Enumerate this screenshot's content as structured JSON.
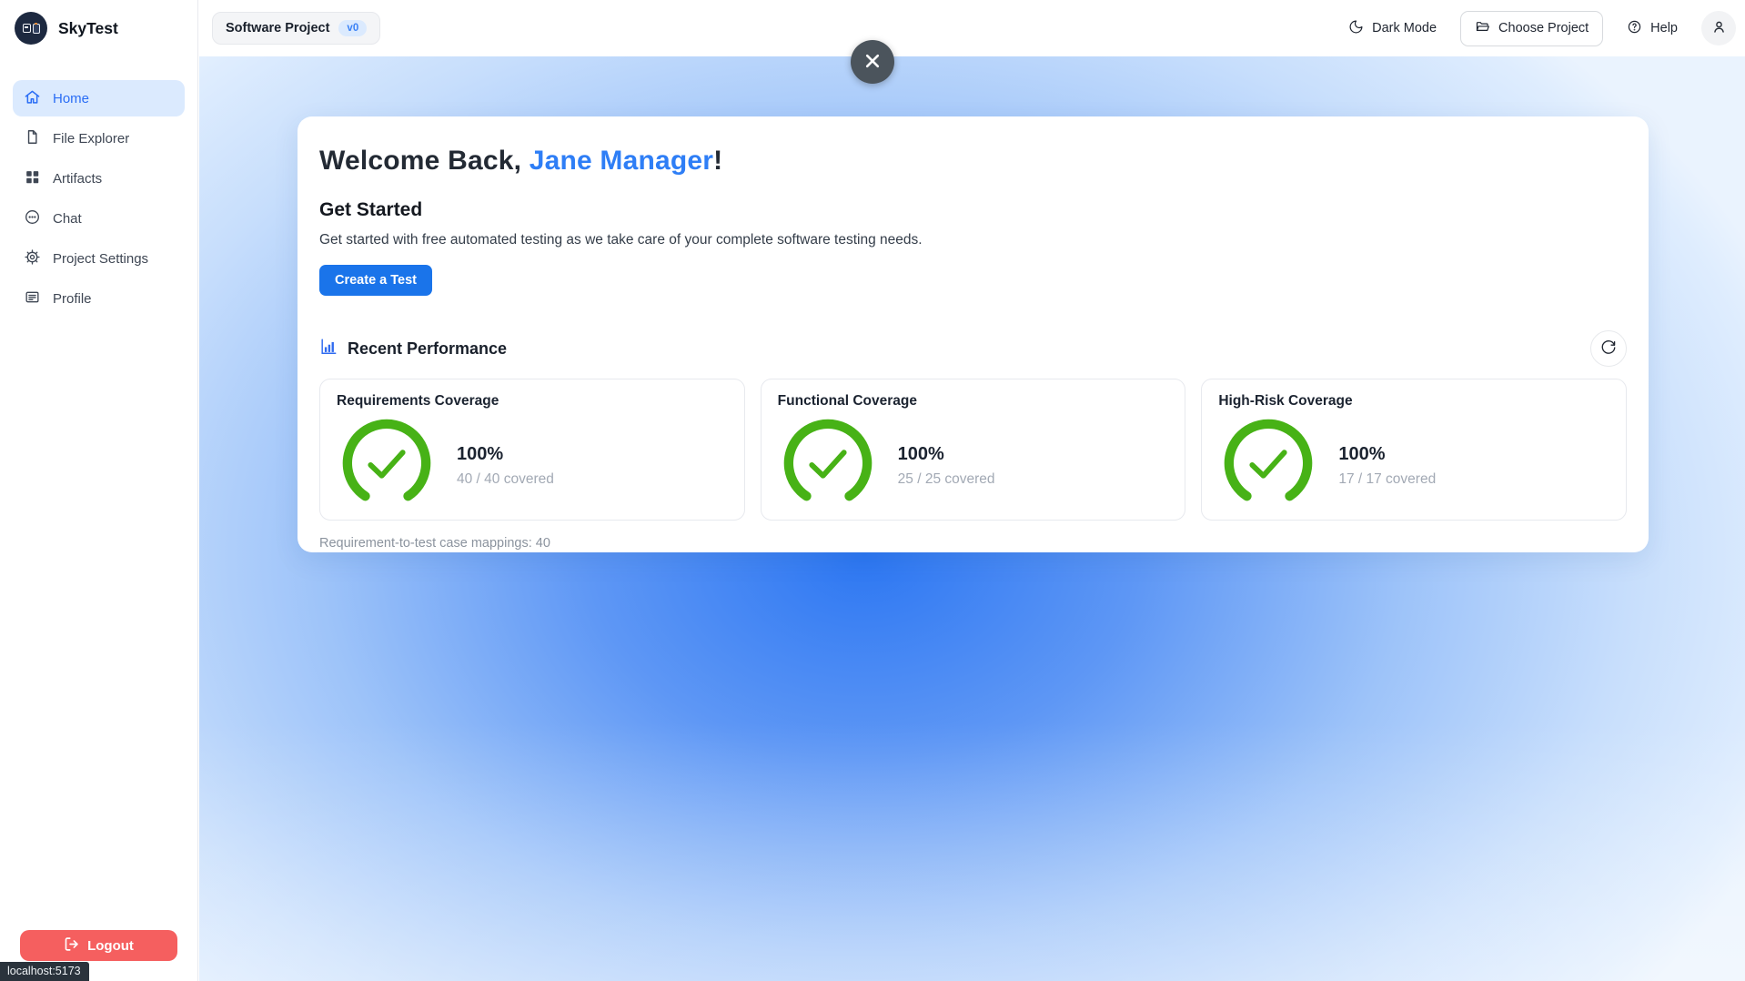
{
  "app": {
    "name": "SkyTest",
    "status_url": "localhost:5173"
  },
  "sidebar": {
    "logo_text": "SkyTest",
    "items": [
      {
        "label": "Home",
        "icon": "home-icon",
        "active": true
      },
      {
        "label": "File Explorer",
        "icon": "file-icon",
        "active": false
      },
      {
        "label": "Artifacts",
        "icon": "grid-icon",
        "active": false
      },
      {
        "label": "Chat",
        "icon": "chat-icon",
        "active": false
      },
      {
        "label": "Project Settings",
        "icon": "gear-icon",
        "active": false
      },
      {
        "label": "Profile",
        "icon": "id-card-icon",
        "active": false
      }
    ],
    "logout_label": "Logout"
  },
  "header": {
    "project_name": "Software Project",
    "project_version": "v0",
    "dark_mode_label": "Dark Mode",
    "choose_project_label": "Choose Project",
    "help_label": "Help"
  },
  "main": {
    "welcome_prefix": "Welcome Back, ",
    "welcome_name": "Jane Manager",
    "welcome_suffix": "!",
    "get_started_title": "Get Started",
    "get_started_description": "Get started with free automated testing as we take care of your complete software testing needs.",
    "create_test_label": "Create a Test",
    "recent_performance_title": "Recent Performance",
    "mappings_note": "Requirement-to-test case mappings: 40"
  },
  "metrics": [
    {
      "title": "Requirements Coverage",
      "percent": "100%",
      "detail": "40 / 40 covered",
      "covered": 40,
      "total": 40
    },
    {
      "title": "Functional Coverage",
      "percent": "100%",
      "detail": "25 / 25 covered",
      "covered": 25,
      "total": 25
    },
    {
      "title": "High-Risk Coverage",
      "percent": "100%",
      "detail": "17 / 17 covered",
      "covered": 17,
      "total": 17
    }
  ],
  "colors": {
    "accent_blue": "#1a74ea",
    "welcome_name_blue": "#2e7ef6",
    "active_nav_bg": "#dbeafe",
    "active_nav_text": "#2a6df5",
    "gauge_green": "#47b216",
    "logout_red": "#f55f5f",
    "close_button_gray": "#4b545c",
    "version_pill_bg": "#dbeafe"
  }
}
